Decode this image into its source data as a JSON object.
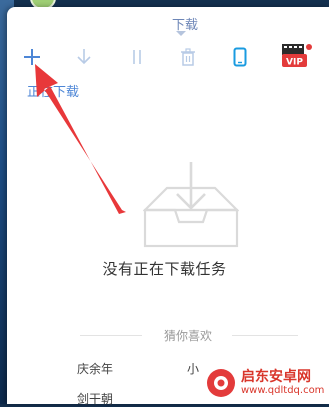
{
  "header": {
    "tab_label": "下载"
  },
  "toolbar": {
    "add": "plus-icon",
    "download": "download-arrow-icon",
    "pause": "pause-icon",
    "delete": "trash-icon",
    "mobile": "phone-icon",
    "vip_label": "VIP"
  },
  "section_label": "正在下载",
  "empty_state": {
    "icon": "empty-inbox-icon",
    "message": "没有正在下载任务"
  },
  "recommendations": {
    "title": "猜你喜欢",
    "items": [
      "庆余年",
      "小",
      "剑干朝"
    ]
  },
  "watermark": {
    "name": "启东安卓网",
    "url": "www.qdltdq.com"
  },
  "colors": {
    "accent": "#4d86d6",
    "pointer": "#e8383a",
    "vip": "#e33b3b"
  }
}
